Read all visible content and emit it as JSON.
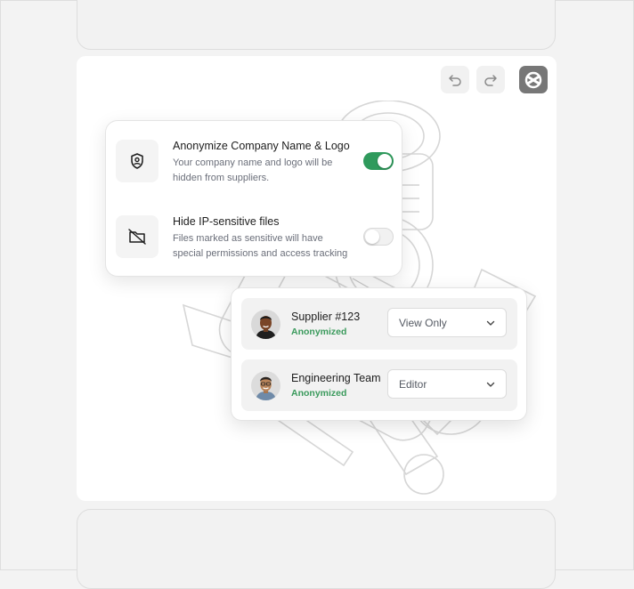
{
  "toolbar": {
    "undo_icon": "undo-icon",
    "redo_icon": "redo-icon",
    "logo_icon": "app-logo-icon"
  },
  "settings": [
    {
      "icon": "shield-icon",
      "title": "Anonymize Company Name & Logo",
      "description": "Your company name and logo will be hidden from suppliers.",
      "enabled": true
    },
    {
      "icon": "hidden-file-icon",
      "title": "Hide IP-sensitive files",
      "description": "Files marked as sensitive will have special permissions and access tracking",
      "enabled": false
    }
  ],
  "members": [
    {
      "name": "Supplier #123",
      "status": "Anonymized",
      "role": "View Only"
    },
    {
      "name": "Engineering Team",
      "status": "Anonymized",
      "role": "Editor"
    }
  ],
  "colors": {
    "accent_green": "#2f9a5c",
    "status_green": "#3a9a5c",
    "text_primary": "#1d1d1d",
    "text_secondary": "#6b6f7a"
  }
}
